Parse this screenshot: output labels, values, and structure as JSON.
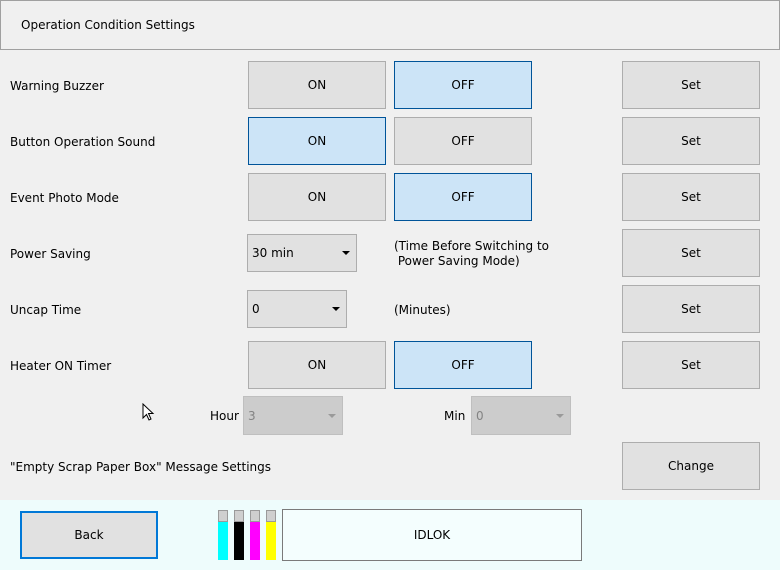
{
  "header": {
    "title": "Operation Condition Settings"
  },
  "rows": {
    "warning_buzzer": {
      "label": "Warning Buzzer",
      "on": "ON",
      "off": "OFF",
      "selected": "OFF",
      "set": "Set"
    },
    "button_sound": {
      "label": "Button Operation Sound",
      "on": "ON",
      "off": "OFF",
      "selected": "ON",
      "set": "Set"
    },
    "event_photo": {
      "label": "Event Photo Mode",
      "on": "ON",
      "off": "OFF",
      "selected": "OFF",
      "set": "Set"
    },
    "power_saving": {
      "label": "Power Saving",
      "value": "30 min",
      "note_line1": "(Time Before Switching to",
      "note_line2": " Power Saving Mode)",
      "set": "Set"
    },
    "uncap_time": {
      "label": "Uncap Time",
      "value": "0",
      "note": "(Minutes)",
      "set": "Set"
    },
    "heater_timer": {
      "label": "Heater ON Timer",
      "on": "ON",
      "off": "OFF",
      "selected": "OFF",
      "set": "Set"
    },
    "heater_time": {
      "hour_label": "Hour",
      "hour_value": "3",
      "min_label": "Min",
      "min_value": "0"
    },
    "scrap_box": {
      "label": "\"Empty Scrap Paper Box\" Message Settings",
      "change": "Change"
    }
  },
  "footer": {
    "back": "Back",
    "status": "IDLOK",
    "inks": [
      {
        "name": "cyan",
        "color": "#00ffff"
      },
      {
        "name": "black",
        "color": "#000000"
      },
      {
        "name": "magenta",
        "color": "#ff00ff"
      },
      {
        "name": "yellow",
        "color": "#ffff00"
      }
    ]
  },
  "colors": {
    "selected_bg": "#cce4f7",
    "selected_border": "#005499",
    "button_bg": "#e1e1e1"
  }
}
